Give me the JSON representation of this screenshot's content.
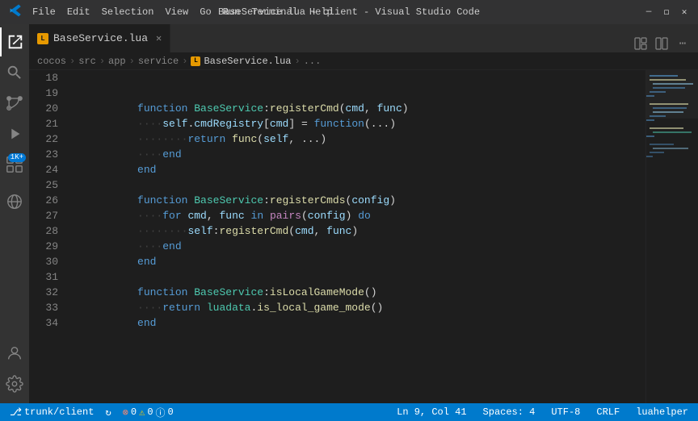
{
  "titleBar": {
    "appIcon": "vscode",
    "menus": [
      "File",
      "Edit",
      "Selection",
      "View",
      "Go",
      "Run",
      "Terminal",
      "Help"
    ],
    "title": "BaseService.lua - client - Visual Studio Code",
    "controls": [
      "minimize",
      "maximize",
      "close"
    ]
  },
  "activityBar": {
    "items": [
      {
        "name": "explorer",
        "icon": "files-icon",
        "active": true
      },
      {
        "name": "search",
        "icon": "search-icon",
        "active": false
      },
      {
        "name": "source-control",
        "icon": "source-control-icon",
        "active": false
      },
      {
        "name": "run-debug",
        "icon": "run-debug-icon",
        "active": false
      },
      {
        "name": "extensions",
        "icon": "extensions-icon",
        "active": false,
        "badge": "1K+"
      },
      {
        "name": "remote-explorer",
        "icon": "remote-icon",
        "active": false
      }
    ],
    "bottomItems": [
      {
        "name": "accounts",
        "icon": "accounts-icon"
      },
      {
        "name": "settings",
        "icon": "settings-icon"
      }
    ]
  },
  "tabBar": {
    "tabs": [
      {
        "label": "BaseService.lua",
        "active": true,
        "modified": false
      }
    ],
    "actions": [
      "layout-icon",
      "split-icon",
      "more-icon"
    ]
  },
  "breadcrumb": {
    "parts": [
      "cocos",
      "src",
      "app",
      "service",
      "BaseService.lua",
      "..."
    ]
  },
  "editor": {
    "startLine": 18,
    "lines": [
      {
        "num": 18,
        "content": ""
      },
      {
        "num": 19,
        "content": "function BaseService:registerCmd(cmd, func)"
      },
      {
        "num": 20,
        "content": "····self.cmdRegistry[cmd] = function(...)"
      },
      {
        "num": 21,
        "content": "········return func(self, ...)"
      },
      {
        "num": 22,
        "content": "····end"
      },
      {
        "num": 23,
        "content": "end"
      },
      {
        "num": 24,
        "content": ""
      },
      {
        "num": 25,
        "content": "function BaseService:registerCmds(config)"
      },
      {
        "num": 26,
        "content": "····for cmd, func in pairs(config) do"
      },
      {
        "num": 27,
        "content": "········self:registerCmd(cmd, func)"
      },
      {
        "num": 28,
        "content": "····end"
      },
      {
        "num": 29,
        "content": "end"
      },
      {
        "num": 30,
        "content": ""
      },
      {
        "num": 31,
        "content": "function BaseService:isLocalGameMode()"
      },
      {
        "num": 32,
        "content": "····return luadata.is_local_game_mode()"
      },
      {
        "num": 33,
        "content": "end"
      },
      {
        "num": 34,
        "content": ""
      }
    ]
  },
  "statusBar": {
    "git": "trunk/client",
    "sync": "sync",
    "errors": "0",
    "warnings": "0",
    "info": "0",
    "position": "Ln 9, Col 41",
    "spaces": "Spaces: 4",
    "encoding": "UTF-8",
    "lineEnding": "CRLF",
    "language": "luahelper"
  }
}
